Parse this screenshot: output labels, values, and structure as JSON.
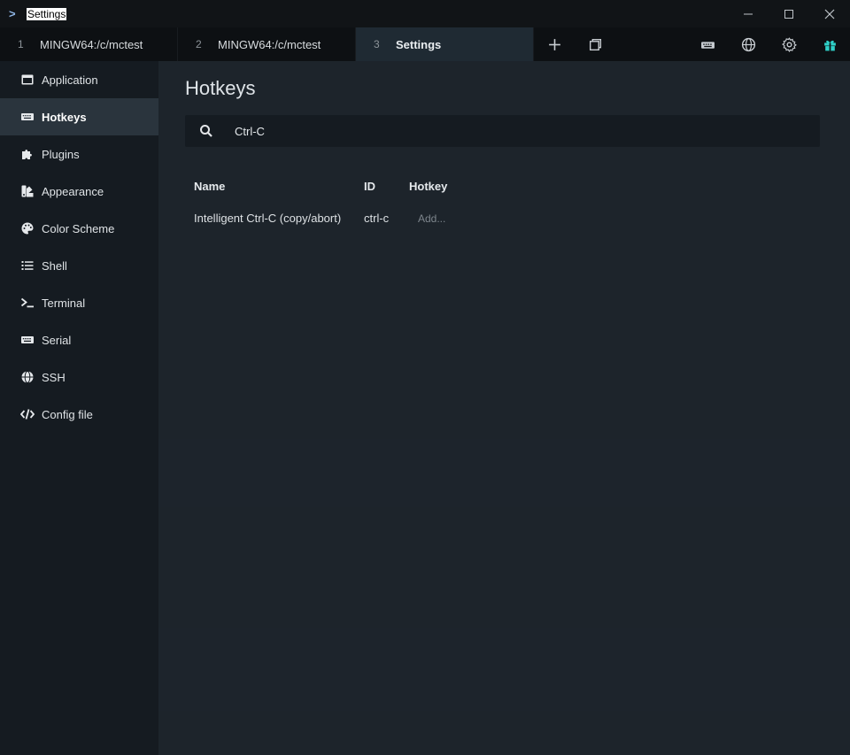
{
  "window": {
    "title": "Settings"
  },
  "tabs": [
    {
      "num": "1",
      "label": "MINGW64:/c/mctest"
    },
    {
      "num": "2",
      "label": "MINGW64:/c/mctest"
    },
    {
      "num": "3",
      "label": "Settings"
    }
  ],
  "sidebar": {
    "items": [
      {
        "label": "Application",
        "icon": "window-icon"
      },
      {
        "label": "Hotkeys",
        "icon": "keyboard-icon"
      },
      {
        "label": "Plugins",
        "icon": "puzzle-icon"
      },
      {
        "label": "Appearance",
        "icon": "swatches-icon"
      },
      {
        "label": "Color Scheme",
        "icon": "palette-icon"
      },
      {
        "label": "Shell",
        "icon": "list-icon"
      },
      {
        "label": "Terminal",
        "icon": "terminal-icon"
      },
      {
        "label": "Serial",
        "icon": "keyboard-icon"
      },
      {
        "label": "SSH",
        "icon": "globe-icon"
      },
      {
        "label": "Config file",
        "icon": "code-icon"
      }
    ]
  },
  "main": {
    "title": "Hotkeys",
    "search": {
      "value": "Ctrl-C"
    },
    "table": {
      "headers": {
        "name": "Name",
        "id": "ID",
        "hotkey": "Hotkey"
      },
      "rows": [
        {
          "name": "Intelligent Ctrl-C (copy/abort)",
          "id": "ctrl-c",
          "hotkey": "Add..."
        }
      ]
    }
  },
  "colors": {
    "active_tab_bg": "#1f2a33",
    "sidebar_bg": "#151b21",
    "accent_gift": "#2fd0c8"
  }
}
